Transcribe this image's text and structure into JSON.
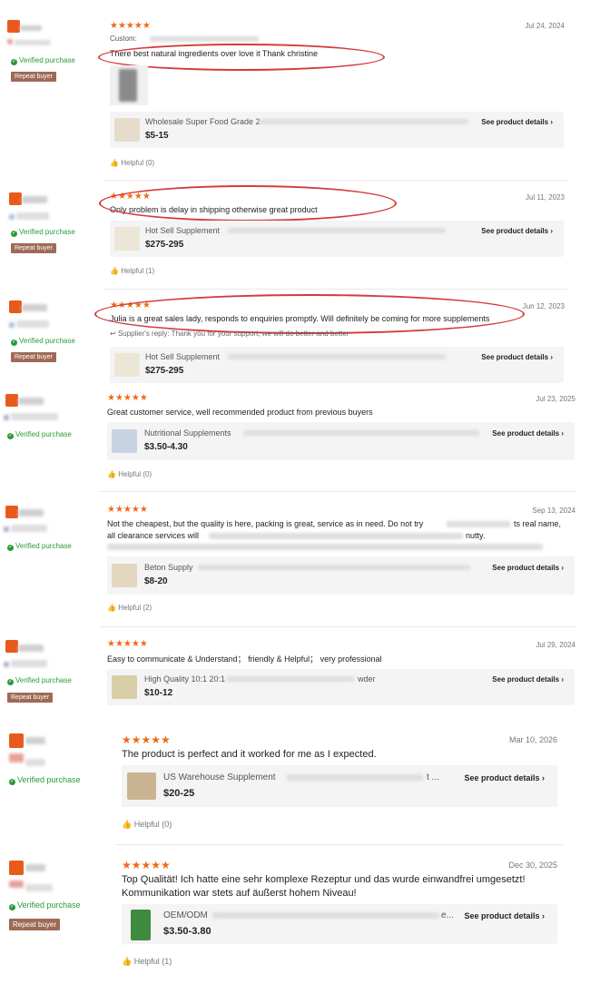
{
  "common": {
    "stars": "★★★★★",
    "verified": "Verified purchase",
    "repeat_buyer": "Repeat buyer",
    "see_details": "See product details",
    "chevron": "›",
    "thumb_icon": "thumbs-up-icon"
  },
  "reviews": [
    {
      "date": "Jul 24, 2024",
      "custom_label": "Custom:",
      "text": "There best natural ingredients over love it Thank christine",
      "product_name": "Wholesale Super Food Grade 2",
      "price": "$5-15",
      "helpful": "Helpful (0)"
    },
    {
      "date": "Jul 11, 2023",
      "text": "Only problem is delay in shipping otherwise great product",
      "product_name": "Hot Sell Supplement",
      "price": "$275-295",
      "helpful": "Helpful (1)"
    },
    {
      "date": "Jun 12, 2023",
      "text": "Julia is a great sales lady, responds to enquiries promptly. Will definitely be coming for more supplements",
      "reply": "Supplier's reply: Thank you for your support, we will do better and better",
      "product_name": "Hot Sell Supplement",
      "price": "$275-295"
    },
    {
      "date": "Jul 23, 2025",
      "text": "Great customer service, well recommended product from previous buyers",
      "product_name": "Nutritional Supplements",
      "price": "$3.50-4.30",
      "helpful": "Helpful (0)"
    },
    {
      "date": "Sep 13, 2024",
      "text": "Not the cheapest, but the quality is here, packing is great, service as in need. Do not try",
      "text_tail": "ts real name,",
      "text2": "all clearance services will",
      "text2_tail": "nutty.",
      "product_name": "Beton Supply",
      "price": "$8-20",
      "helpful": "Helpful (2)"
    },
    {
      "date": "Jul 29, 2024",
      "text": "Easy to communicate & Understand；  friendly & Helpful；  very professional",
      "product_name": "High Quality 10:1 20:1",
      "product_tail": "wder",
      "price": "$10-12"
    },
    {
      "date": "Mar 10, 2026",
      "text": "The product is perfect and it worked for me as I expected.",
      "product_name": "US Warehouse Supplement",
      "product_tail": "t ...",
      "price": "$20-25",
      "helpful": "Helpful (0)"
    },
    {
      "date": "Dec 30, 2025",
      "text": "Top Qualität! Ich hatte eine sehr komplexe Rezeptur und das wurde einwandfrei umgesetzt!",
      "text2": "Kommunikation war stets auf äußerst hohem Niveau!",
      "product_name": "OEM/ODM",
      "product_tail": "e...",
      "price": "$3.50-3.80",
      "helpful": "Helpful (1)"
    }
  ]
}
